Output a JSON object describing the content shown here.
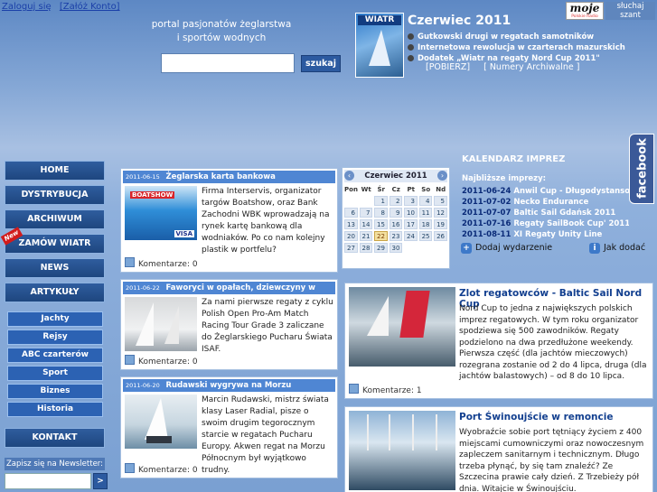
{
  "header": {
    "login_link": "Zaloguj się",
    "register_link": "[Załóż Konto]",
    "tagline_line1": "portal pasjonatów żeglarstwa",
    "tagline_line2": "i sportów wodnych",
    "search_button": "szukaj",
    "search_value": ""
  },
  "magazine": {
    "brand": "WIATR",
    "issue_title": "Czerwiec 2011",
    "headlines": [
      "Gutkowski drugi w regatach samotników",
      "Internetowa rewolucja w czarterach mazurskich",
      "Dodatek „Wiatr na regaty Nord Cup 2011\""
    ],
    "download_link": "[POBIERZ]",
    "archive_link": "[ Numery Archiwalne ]"
  },
  "radio": {
    "logo_text": "moje",
    "logo_subtext": "Polskie Radio",
    "listen_line1": "słuchaj",
    "listen_line2": "szant"
  },
  "menu": {
    "main": [
      "HOME",
      "DYSTRYBUCJA",
      "ARCHIWUM",
      "ZAMÓW WIATR",
      "NEWS",
      "ARTYKUŁY"
    ],
    "new_badge": "New",
    "sub": [
      "Jachty",
      "Rejsy",
      "ABC czarterów",
      "Sport",
      "Biznes",
      "Historia"
    ],
    "contact": "KONTAKT",
    "newsletter_label": "Zapisz się na Newsletter:",
    "newsletter_button": ">"
  },
  "news": [
    {
      "date": "2011-06-15",
      "title": "Żeglarska karta bankowa",
      "body": "Firma Interservis, organizator targów Boatshow, oraz Bank Zachodni WBK wprowadzają na rynek kartę bankową dla wodniaków. Po co nam kolejny plastik w portfelu?",
      "comments": "Komentarze: 0",
      "thumb_text1": "BOATSHOW",
      "thumb_text2": "VISA"
    },
    {
      "date": "2011-06-22",
      "title": "Faworyci w opałach, dziewczyny w natarciu",
      "body": "Za nami pierwsze regaty z cyklu Polish Open Pro-Am Match Racing Tour Grade 3 zaliczane do Żeglarskiego Pucharu Świata ISAF.",
      "comments": "Komentarze: 0"
    },
    {
      "date": "2011-06-20",
      "title": "Rudawski wygrywa na Morzu Północnym",
      "body": "Marcin Rudawski, mistrz świata klasy Laser Radial, pisze o swoim drugim tegorocznym starcie w regatach Pucharu Europy. Akwen regat na Morzu Północnym był wyjątkowo trudny.",
      "comments": "Komentarze: 0"
    }
  ],
  "calendar": {
    "month": "Czerwiec 2011",
    "prev": "‹",
    "next": "›",
    "weekdays": [
      "Pon",
      "Wt",
      "Śr",
      "Cz",
      "Pt",
      "So",
      "Nd"
    ],
    "days": [
      "",
      "",
      "1",
      "2",
      "3",
      "4",
      "5",
      "6",
      "7",
      "8",
      "9",
      "10",
      "11",
      "12",
      "13",
      "14",
      "15",
      "16",
      "17",
      "18",
      "19",
      "20",
      "21",
      "22",
      "23",
      "24",
      "25",
      "26",
      "27",
      "28",
      "29",
      "30",
      "",
      "",
      ""
    ],
    "today": "22"
  },
  "events": {
    "title": "KALENDARZ IMPREZ",
    "subtitle": "Najbliższe imprezy:",
    "items": [
      {
        "date": "2011-06-24",
        "name": "Anwil Cup - Długodystansowe Mi"
      },
      {
        "date": "2011-07-02",
        "name": "Necko Endurance"
      },
      {
        "date": "2011-07-07",
        "name": "Baltic Sail Gdańsk 2011"
      },
      {
        "date": "2011-07-16",
        "name": "Regaty SailBook Cup' 2011"
      },
      {
        "date": "2011-08-11",
        "name": "XI Regaty Unity Line"
      }
    ],
    "add_event": "Dodaj wydarzenie",
    "how_to_add": "Jak dodać",
    "add_icon": "+",
    "info_icon": "i"
  },
  "social": {
    "facebook_label": "facebook"
  },
  "features": [
    {
      "title": "Zlot regatowców - Baltic Sail Nord Cup",
      "body": "Nord Cup to jedna z największych polskich imprez regatowych. W tym roku organizator spodziewa się 500 zawodników. Regaty podzielono na dwa przedłużone weekendy. Pierwsza część (dla jachtów mieczowych) rozegrana zostanie od 2 do 4 lipca, druga (dla jachtów balastowych) – od 8 do 10 lipca.",
      "comments": "Komentarze: 1"
    },
    {
      "title": "Port Świnoujście w remoncie",
      "body": "Wyobraźcie sobie port tętniący życiem z 400 miejscami cumowniczymi oraz nowoczesnym zapleczem sanitarnym i technicznym. Długo trzeba płynąć, by się tam znaleźć? Ze Szczecina prawie cały dzień. Z Trzebieży pół dnia. Witajcie w Świnoujściu."
    }
  ]
}
